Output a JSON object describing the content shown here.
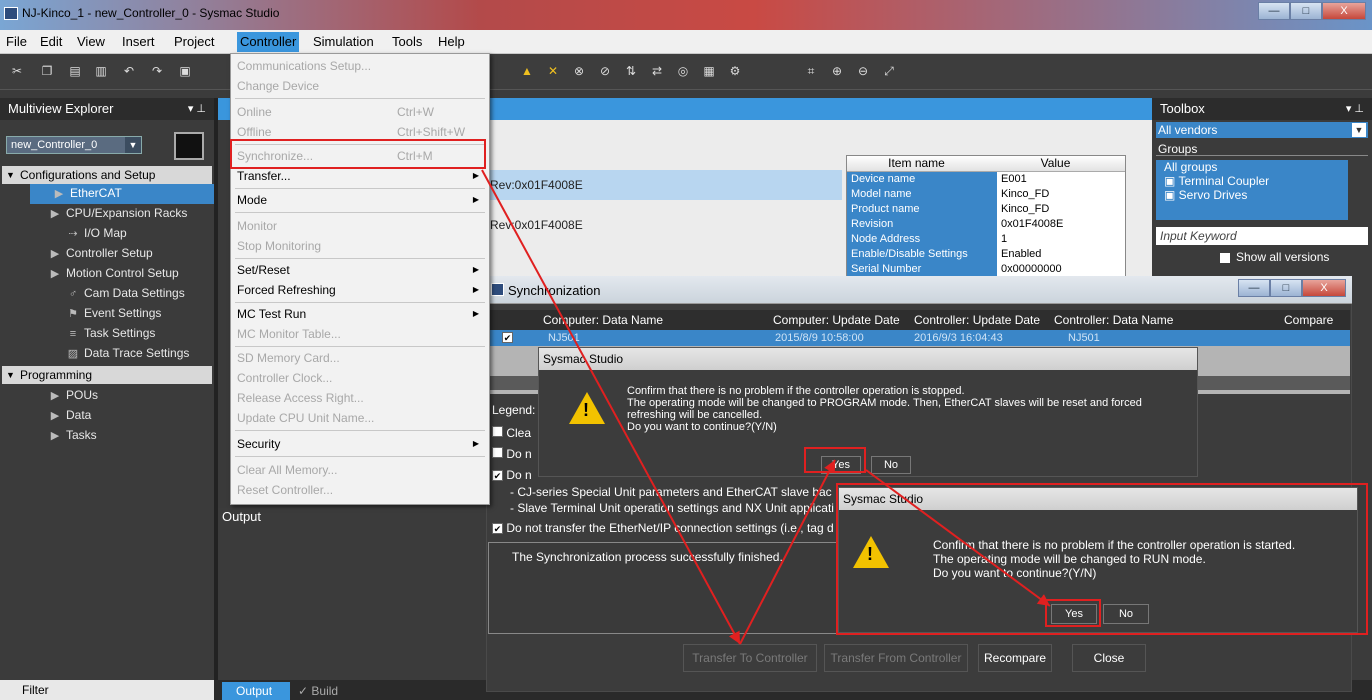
{
  "window": {
    "title": "NJ-Kinco_1 - new_Controller_0 - Sysmac Studio",
    "min": "—",
    "max": "□",
    "close": "X"
  },
  "menubar": [
    "File",
    "Edit",
    "View",
    "Insert",
    "Project",
    "Controller",
    "Simulation",
    "Tools",
    "Help"
  ],
  "explorer": {
    "title": "Multiview Explorer",
    "controller": "new_Controller_0",
    "groups": {
      "config": "Configurations and Setup",
      "programming": "Programming"
    },
    "config_items": [
      "EtherCAT",
      "CPU/Expansion Racks",
      "I/O Map",
      "Controller Setup",
      "Motion Control Setup",
      "Cam Data Settings",
      "Event Settings",
      "Task Settings",
      "Data Trace Settings"
    ],
    "prog_items": [
      "POUs",
      "Data",
      "Tasks"
    ],
    "filter": "Filter"
  },
  "controller_menu": {
    "items": [
      {
        "label": "Communications Setup...",
        "disabled": true
      },
      {
        "label": "Change Device",
        "disabled": true
      },
      {
        "label": "Online",
        "shortcut": "Ctrl+W",
        "disabled": true
      },
      {
        "label": "Offline",
        "shortcut": "Ctrl+Shift+W",
        "disabled": true
      },
      {
        "label": "Synchronize...",
        "shortcut": "Ctrl+M",
        "disabled": true
      },
      {
        "label": "Transfer...",
        "disabled": false
      },
      {
        "label": "Mode",
        "disabled": false
      },
      {
        "label": "Monitor",
        "disabled": true
      },
      {
        "label": "Stop Monitoring",
        "disabled": true
      },
      {
        "label": "Set/Reset",
        "disabled": false
      },
      {
        "label": "Forced Refreshing",
        "disabled": false
      },
      {
        "label": "MC Test Run",
        "disabled": false
      },
      {
        "label": "MC Monitor Table...",
        "disabled": true
      },
      {
        "label": "SD Memory Card...",
        "disabled": true
      },
      {
        "label": "Controller Clock...",
        "disabled": true
      },
      {
        "label": "Release Access Right...",
        "disabled": true
      },
      {
        "label": "Update CPU Unit Name...",
        "disabled": true
      },
      {
        "label": "Security",
        "disabled": false
      },
      {
        "label": "Clear All Memory...",
        "disabled": true
      },
      {
        "label": "Reset Controller...",
        "disabled": true
      }
    ]
  },
  "editor": {
    "rev1": "Rev:0x01F4008E",
    "rev2": "Rev:0x01F4008E",
    "prop_headers": [
      "Item name",
      "Value"
    ],
    "props": [
      [
        "Device name",
        "E001"
      ],
      [
        "Model name",
        "Kinco_FD"
      ],
      [
        "Product name",
        "Kinco_FD"
      ],
      [
        "Revision",
        "0x01F4008E"
      ],
      [
        "Node Address",
        "1"
      ],
      [
        "Enable/Disable Settings",
        "Enabled"
      ],
      [
        "Serial Number",
        "0x00000000"
      ]
    ]
  },
  "toolbox": {
    "title": "Toolbox",
    "vendor": "All vendors",
    "groups_label": "Groups",
    "groups": [
      "All groups",
      "Terminal Coupler",
      "Servo Drives"
    ],
    "input_keyword": "Input Keyword",
    "show_all": "Show all versions"
  },
  "output": {
    "title": "Output",
    "tabs": [
      "Output",
      "Build"
    ]
  },
  "sync": {
    "title": "Synchronization",
    "columns": [
      "Computer: Data Name",
      "Computer: Update Date",
      "Controller: Update Date",
      "Controller: Data Name",
      "Compare"
    ],
    "row": [
      "NJ501",
      "2015/8/9 10:58:00",
      "2016/9/3 16:04:43",
      "NJ501"
    ],
    "legend": "Legend:",
    "options": [
      "Clea",
      "Do n",
      "Do n",
      "- CJ-series Special Unit parameters and EtherCAT slave bac",
      "- Slave Terminal Unit operation settings and NX Unit applicati",
      "Do not transfer the EtherNet/IP connection settings (i.e., tag d"
    ],
    "result": "The Synchronization process successfully finished.",
    "buttons": [
      "Transfer To Controller",
      "Transfer From Controller",
      "Recompare",
      "Close"
    ]
  },
  "msg1": {
    "title": "Sysmac Studio",
    "lines": [
      "Confirm that there is no problem if the controller operation is stopped.",
      "The operating mode will be changed to PROGRAM mode. Then, EtherCAT slaves will be reset and forced",
      "refreshing will be cancelled.",
      "Do you want to continue?(Y/N)"
    ],
    "yes": "Yes",
    "no": "No"
  },
  "msg2": {
    "title": "Sysmac Studio",
    "lines": [
      "Confirm that there is no problem if the controller operation is started.",
      "The operating mode will be changed to RUN mode.",
      "Do you want to continue?(Y/N)"
    ],
    "yes": "Yes",
    "no": "No"
  },
  "colors": {
    "accent": "#3a96dd",
    "highlight": "#e02020",
    "warning": "#f2c200"
  }
}
